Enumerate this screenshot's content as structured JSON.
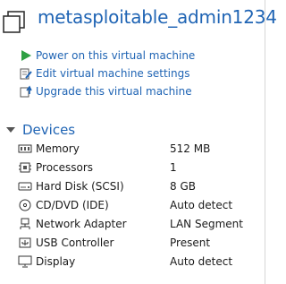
{
  "vm": {
    "title": "metasploitable_admin1234"
  },
  "actions": [
    {
      "label": "Power on this virtual machine",
      "icon": "play-icon"
    },
    {
      "label": "Edit virtual machine settings",
      "icon": "edit-settings-icon"
    },
    {
      "label": "Upgrade this virtual machine",
      "icon": "upgrade-icon"
    }
  ],
  "devices": {
    "heading": "Devices",
    "items": [
      {
        "name": "Memory",
        "value": "512 MB",
        "icon": "memory-icon"
      },
      {
        "name": "Processors",
        "value": "1",
        "icon": "processor-icon"
      },
      {
        "name": "Hard Disk (SCSI)",
        "value": "8 GB",
        "icon": "hard-disk-icon"
      },
      {
        "name": "CD/DVD (IDE)",
        "value": "Auto detect",
        "icon": "cd-dvd-icon"
      },
      {
        "name": "Network Adapter",
        "value": "LAN Segment",
        "icon": "network-adapter-icon"
      },
      {
        "name": "USB Controller",
        "value": "Present",
        "icon": "usb-icon"
      },
      {
        "name": "Display",
        "value": "Auto detect",
        "icon": "display-icon"
      }
    ]
  },
  "colors": {
    "accent": "#1f64b4",
    "play": "#2ea043"
  }
}
